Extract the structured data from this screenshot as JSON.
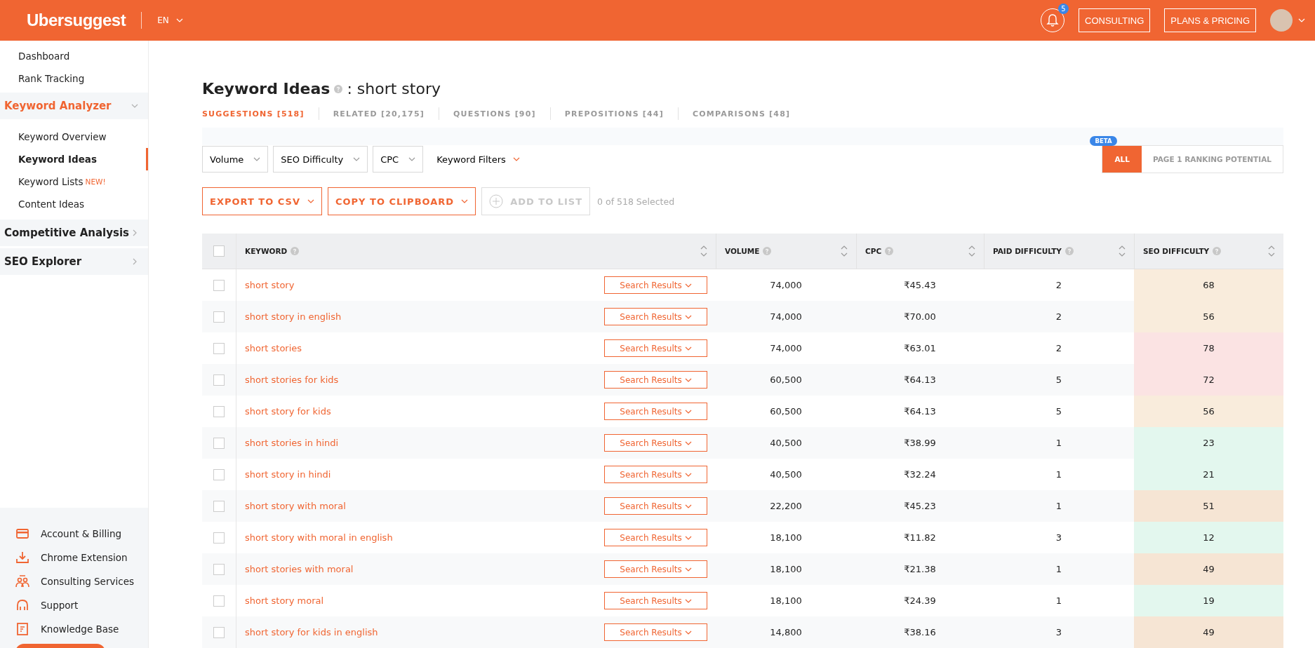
{
  "header": {
    "logo": "Ubersuggest",
    "language": "EN",
    "notifications": "5",
    "buttons": [
      "CONSULTING",
      "PLANS & PRICING"
    ]
  },
  "sidebar": {
    "top_items": [
      "Dashboard",
      "Rank Tracking"
    ],
    "sections": [
      {
        "label": "Keyword Analyzer",
        "expanded": true,
        "children": [
          {
            "label": "Keyword Overview",
            "selected": false
          },
          {
            "label": "Keyword Ideas",
            "selected": true
          },
          {
            "label": "Keyword Lists",
            "badge": "NEW!",
            "selected": false
          },
          {
            "label": "Content Ideas",
            "selected": false
          }
        ]
      },
      {
        "label": "Competitive Analysis",
        "expanded": false
      },
      {
        "label": "SEO Explorer",
        "expanded": false
      }
    ],
    "bottom_items": [
      {
        "label": "Account & Billing",
        "kind": "card"
      },
      {
        "label": "Chrome Extension",
        "kind": "download"
      },
      {
        "label": "Consulting Services",
        "kind": "people"
      },
      {
        "label": "Support",
        "kind": "headset"
      },
      {
        "label": "Knowledge Base",
        "kind": "doc"
      }
    ]
  },
  "page": {
    "title": "Keyword Ideas",
    "subject": ": short story"
  },
  "tabs": [
    {
      "label": "SUGGESTIONS [518]",
      "selected": true
    },
    {
      "label": "RELATED [20,175]",
      "selected": false
    },
    {
      "label": "QUESTIONS [90]",
      "selected": false
    },
    {
      "label": "PREPOSITIONS [44]",
      "selected": false
    },
    {
      "label": "COMPARISONS [48]",
      "selected": false
    }
  ],
  "filters": [
    {
      "label": "Volume",
      "kind": "dropdown"
    },
    {
      "label": "SEO Difficulty",
      "kind": "dropdown"
    },
    {
      "label": "CPC",
      "kind": "dropdown"
    },
    {
      "label": "Keyword Filters",
      "kind": "link"
    }
  ],
  "view_toggle": {
    "badge": "BETA",
    "options": [
      {
        "label": "ALL",
        "selected": true
      },
      {
        "label": "PAGE 1 RANKING POTENTIAL",
        "selected": false
      }
    ]
  },
  "actions": [
    {
      "label": "EXPORT TO CSV",
      "kind": "menu",
      "disabled": false
    },
    {
      "label": "COPY TO CLIPBOARD",
      "kind": "menu",
      "disabled": false
    },
    {
      "label": "ADD TO LIST",
      "kind": "add",
      "disabled": true
    }
  ],
  "selection_count": "0 of 518 Selected",
  "table": {
    "select_all_checked": false,
    "columns": [
      "KEYWORD",
      "VOLUME",
      "CPC",
      "PAID DIFFICULTY",
      "SEO DIFFICULTY"
    ],
    "rows": [
      {
        "keyword": "short story",
        "button": "Search Results",
        "volume": "74,000",
        "cpc": "₹45.43",
        "paid": "2",
        "seo": "68",
        "color": "#f9ecdc",
        "checked": false
      },
      {
        "keyword": "short story in english",
        "button": "Search Results",
        "volume": "74,000",
        "cpc": "₹70.00",
        "paid": "2",
        "seo": "56",
        "color": "#f9ecdc",
        "checked": false
      },
      {
        "keyword": "short stories",
        "button": "Search Results",
        "volume": "74,000",
        "cpc": "₹63.01",
        "paid": "2",
        "seo": "78",
        "color": "#fbe3e3",
        "checked": false
      },
      {
        "keyword": "short stories for kids",
        "button": "Search Results",
        "volume": "60,500",
        "cpc": "₹64.13",
        "paid": "5",
        "seo": "72",
        "color": "#fbe3e3",
        "checked": false
      },
      {
        "keyword": "short story for kids",
        "button": "Search Results",
        "volume": "60,500",
        "cpc": "₹64.13",
        "paid": "5",
        "seo": "56",
        "color": "#f9ecdc",
        "checked": false
      },
      {
        "keyword": "short stories in hindi",
        "button": "Search Results",
        "volume": "40,500",
        "cpc": "₹38.99",
        "paid": "1",
        "seo": "23",
        "color": "#e3f7ee",
        "checked": false
      },
      {
        "keyword": "short story in hindi",
        "button": "Search Results",
        "volume": "40,500",
        "cpc": "₹32.24",
        "paid": "1",
        "seo": "21",
        "color": "#e3f7ee",
        "checked": false
      },
      {
        "keyword": "short story with moral",
        "button": "Search Results",
        "volume": "22,200",
        "cpc": "₹45.23",
        "paid": "1",
        "seo": "51",
        "color": "#f6e5d4",
        "checked": false
      },
      {
        "keyword": "short story with moral in english",
        "button": "Search Results",
        "volume": "18,100",
        "cpc": "₹11.82",
        "paid": "3",
        "seo": "12",
        "color": "#e3f7ee",
        "checked": false
      },
      {
        "keyword": "short stories with moral",
        "button": "Search Results",
        "volume": "18,100",
        "cpc": "₹21.38",
        "paid": "1",
        "seo": "49",
        "color": "#f6e5d4",
        "checked": false
      },
      {
        "keyword": "short story moral",
        "button": "Search Results",
        "volume": "18,100",
        "cpc": "₹24.39",
        "paid": "1",
        "seo": "19",
        "color": "#e3f7ee",
        "checked": false
      },
      {
        "keyword": "short story for kids in english",
        "button": "Search Results",
        "volume": "14,800",
        "cpc": "₹38.16",
        "paid": "3",
        "seo": "49",
        "color": "#f6e5d4",
        "checked": false
      }
    ]
  }
}
